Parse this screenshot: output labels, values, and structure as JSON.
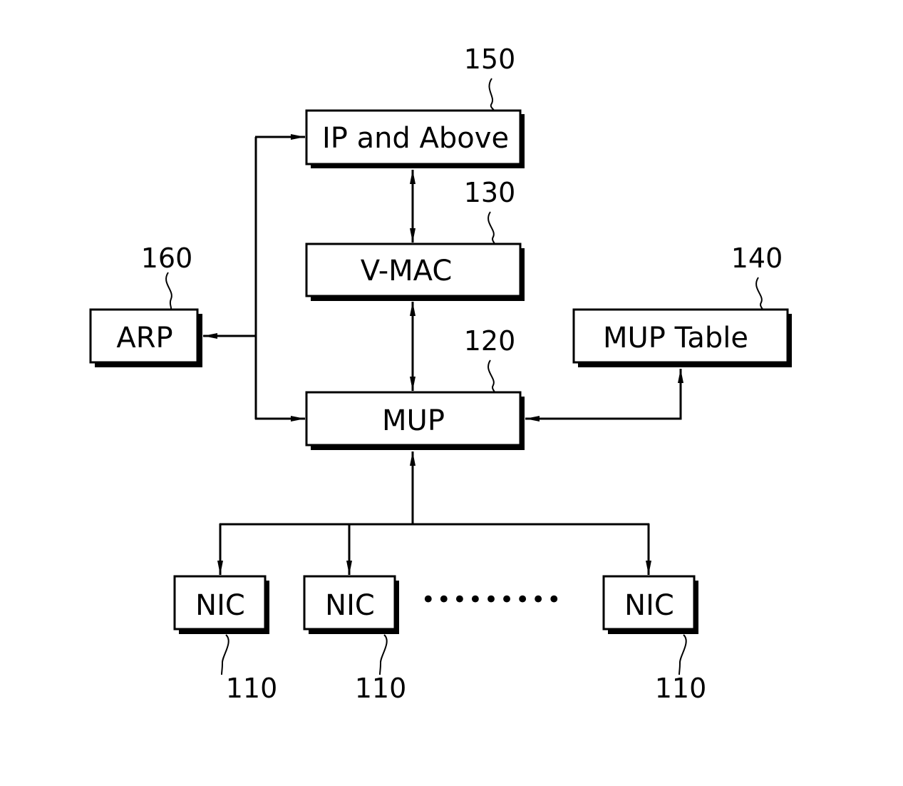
{
  "diagram": {
    "title": "",
    "colors": {
      "stroke": "#000000",
      "background": "#ffffff"
    },
    "blocks": {
      "ip": {
        "label": "IP and Above",
        "ref": "150"
      },
      "vmac": {
        "label": "V-MAC",
        "ref": "130"
      },
      "mup": {
        "label": "MUP",
        "ref": "120"
      },
      "mup_table": {
        "label": "MUP Table",
        "ref": "140"
      },
      "arp": {
        "label": "ARP",
        "ref": "160"
      },
      "nic1": {
        "label": "NIC",
        "ref": "110"
      },
      "nic2": {
        "label": "NIC",
        "ref": "110"
      },
      "nic3": {
        "label": "NIC",
        "ref": "110"
      }
    },
    "ellipsis": "•••••••••",
    "connections": [
      {
        "from": "ip",
        "to": "vmac",
        "direction": "bidirectional"
      },
      {
        "from": "vmac",
        "to": "mup",
        "direction": "bidirectional"
      },
      {
        "from": "junction",
        "to": "ip",
        "direction": "forward"
      },
      {
        "from": "junction",
        "to": "arp",
        "direction": "forward"
      },
      {
        "from": "junction",
        "to": "mup",
        "direction": "forward"
      },
      {
        "from": "mup",
        "to": "mup_table",
        "direction": "bidirectional"
      },
      {
        "from": "bus",
        "to": "mup",
        "direction": "forward"
      },
      {
        "from": "bus",
        "to": "nic1",
        "direction": "forward"
      },
      {
        "from": "bus",
        "to": "nic2",
        "direction": "forward"
      },
      {
        "from": "bus",
        "to": "nic3",
        "direction": "forward"
      }
    ]
  }
}
